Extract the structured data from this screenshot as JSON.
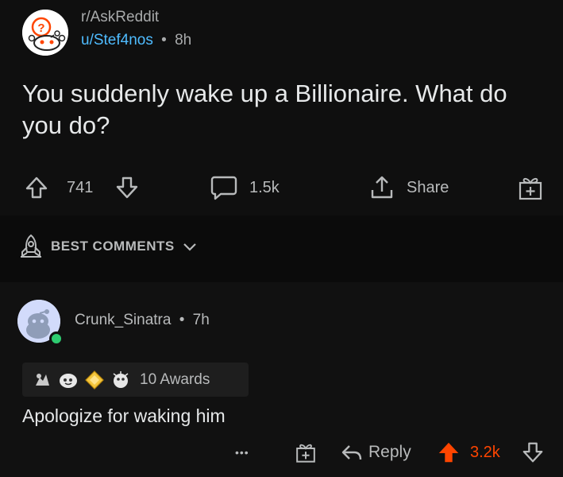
{
  "post": {
    "subreddit": "r/AskReddit",
    "author": "u/Stef4nos",
    "separator": "•",
    "age": "8h",
    "title": "You suddenly wake up a Billionaire. What do you do?",
    "upvotes": "741",
    "comments": "1.5k",
    "share_label": "Share"
  },
  "sort": {
    "label": "BEST COMMENTS"
  },
  "comment": {
    "username": "Crunk_Sinatra",
    "separator": "•",
    "age": "7h",
    "awards_label": "10 Awards",
    "body": "Apologize for waking him",
    "more": "•••",
    "reply_label": "Reply",
    "score": "3.2k",
    "score_color": "#ff4500"
  },
  "colors": {
    "author_link": "#4fbcff",
    "online": "#2ecc71",
    "upvote_active": "#ff4500"
  }
}
